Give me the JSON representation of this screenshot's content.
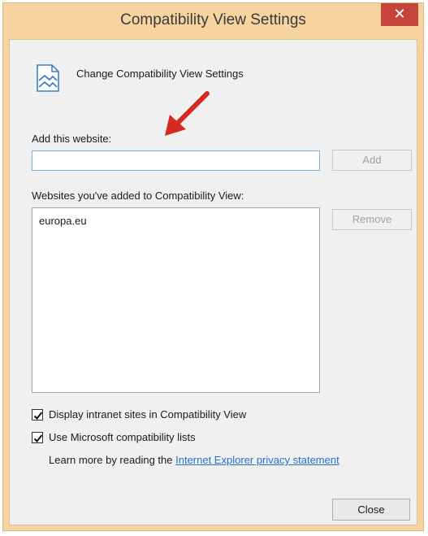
{
  "window": {
    "title": "Compatibility View Settings",
    "close_glyph": "✕"
  },
  "header": {
    "icon": "compatibility-view-icon",
    "text": "Change Compatibility View Settings"
  },
  "add_section": {
    "label": "Add this website:",
    "input_value": "",
    "add_button": "Add"
  },
  "list_section": {
    "label": "Websites you've added to Compatibility View:",
    "items": [
      "europa.eu"
    ],
    "remove_button": "Remove"
  },
  "options": [
    {
      "label": "Display intranet sites in Compatibility View",
      "checked": true
    },
    {
      "label": "Use Microsoft compatibility lists",
      "checked": true
    }
  ],
  "learn_more": {
    "prefix": "Learn more by reading the",
    "link": "Internet Explorer privacy statement"
  },
  "footer": {
    "close_button": "Close"
  },
  "colors": {
    "title_bar": "#f6d39f",
    "close_button": "#c7443b",
    "link": "#2a6fcf",
    "arrow": "#d42a1f"
  }
}
